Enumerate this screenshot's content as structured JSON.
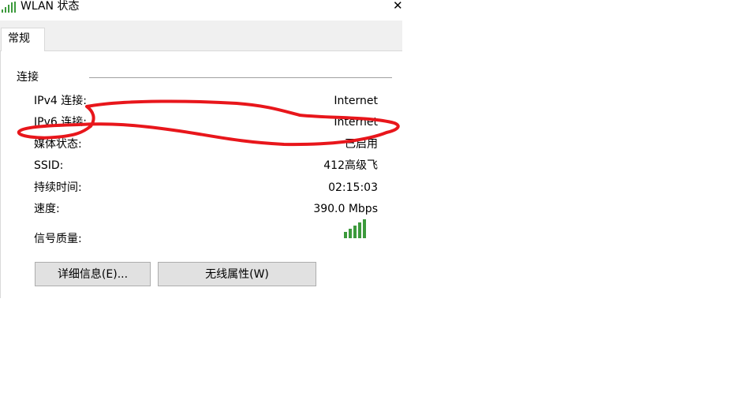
{
  "window": {
    "title": "WLAN 状态",
    "close_glyph": "✕",
    "icon": "wifi-signal-icon"
  },
  "tabs": [
    {
      "label": "常规",
      "selected": true
    }
  ],
  "connection": {
    "group_label": "连接",
    "rows": [
      {
        "label": "IPv4 连接:",
        "value": "Internet"
      },
      {
        "label": "IPv6 连接:",
        "value": "Internet"
      },
      {
        "label": "媒体状态:",
        "value": "已启用"
      },
      {
        "label": "SSID:",
        "value": "412高级飞"
      },
      {
        "label": "持续时间:",
        "value": "02:15:03"
      },
      {
        "label": "速度:",
        "value": "390.0 Mbps"
      }
    ],
    "signal": {
      "label": "信号质量:",
      "bars_total": 5,
      "bars_filled": 5,
      "icon": "signal-strength-icon",
      "color": "#3c9a3c"
    }
  },
  "buttons": {
    "details": "详细信息(E)...",
    "wireless_properties": "无线属性(W)"
  },
  "annotation": {
    "color": "#e8161b"
  }
}
